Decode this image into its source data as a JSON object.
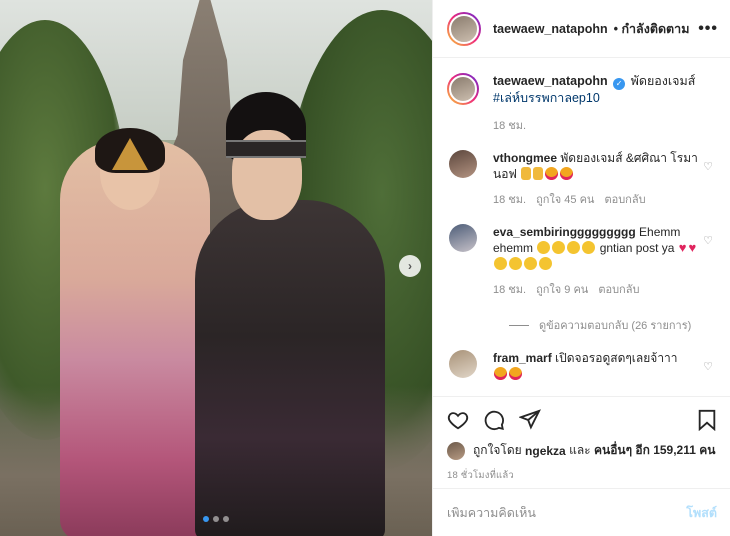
{
  "post": {
    "username": "taewaew_natapohn",
    "follow_status": "• กำลังติดตาม",
    "more_icon": "more-horizontal-icon"
  },
  "caption": {
    "username": "taewaew_natapohn",
    "text": "พัดยองเจมส์",
    "hashtag": "#เล่ห์บรรพกาลep10",
    "time": "18 ชม."
  },
  "comments": [
    {
      "username": "vthongmee",
      "text": "พัดยองเจมส์ &ศศิณา โรมานอฟ",
      "time": "18 ชม.",
      "likes": "ถูกใจ 45 คน",
      "reply": "ตอบกลับ",
      "avatar_color": "#7a6256"
    },
    {
      "username": "eva_sembiringgggggggg",
      "text": "Ehemm ehemm",
      "text2": "gntian post ya",
      "time": "18 ชม.",
      "likes": "ถูกใจ 9 คน",
      "reply": "ตอบกลับ",
      "avatar_color": "#8c9bb0"
    },
    {
      "username": "fram_marf",
      "text": "เปิดจอรอดูสดๆเลยจ้าาา",
      "avatar_color": "#c7b8a4"
    }
  ],
  "view_replies": "ดูข้อความตอบกลับ (26 รายการ)",
  "likes": {
    "prefix": "ถูกใจโดย",
    "user": "ngekza",
    "conj": "และ",
    "others": "คนอื่นๆ อีก 159,211 คน"
  },
  "time_ago": "18 ชั่วโมงที่แล้ว",
  "add_comment": {
    "placeholder": "เพิ่มความคิดเห็น",
    "post_label": "โพสต์"
  },
  "carousel": {
    "total_slides": 3,
    "current_slide": 1
  },
  "colors": {
    "accent": "#3897f0",
    "heart": "#e0245e",
    "muted": "#8e8e8e",
    "post_disabled": "#b2dffc"
  }
}
